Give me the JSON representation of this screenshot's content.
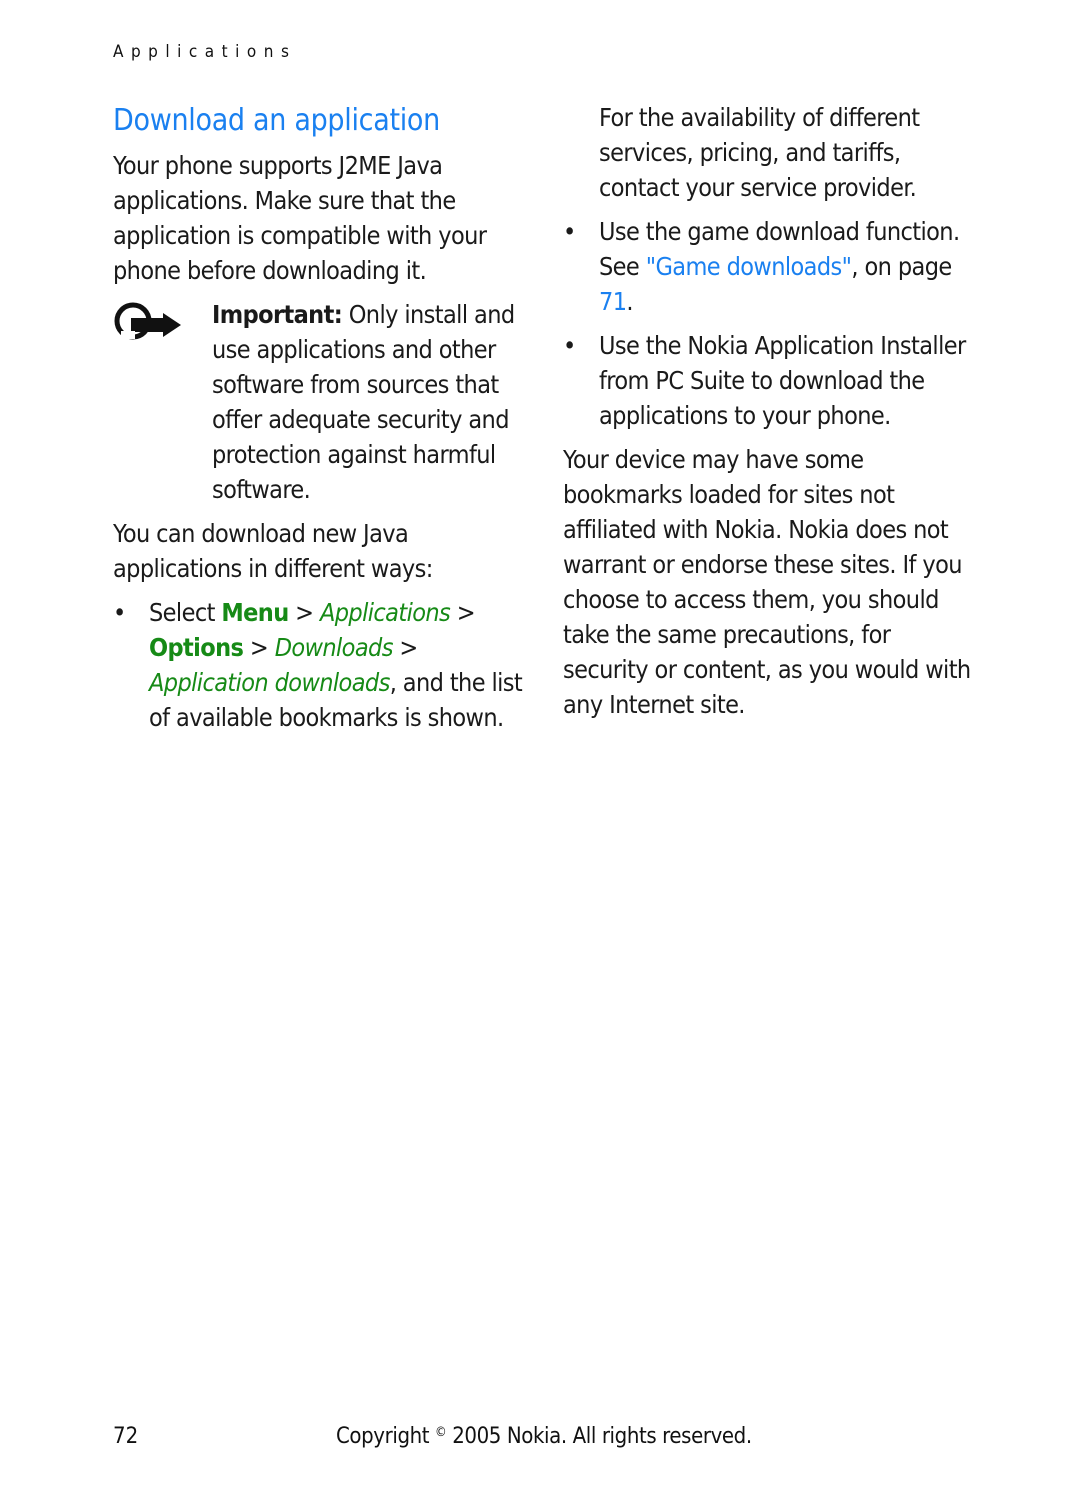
{
  "running_head": "Applications",
  "left_column": {
    "title": "Download an application",
    "intro": "Your phone supports J2ME Java applications. Make sure that the application is compatible with your phone before downloading it.",
    "note": {
      "icon": "important-note-icon",
      "label": "Important:",
      "text": " Only install and use applications and other software from sources that offer adequate security and protection against harmful software."
    },
    "ways_intro": "You can download new Java applications in different ways:",
    "bullet1": {
      "prefix": "Select ",
      "menu": "Menu",
      "sep1": " > ",
      "applications": "Applications",
      "sep2": " > ",
      "options": "Options",
      "sep3": " > ",
      "downloads": "Downloads",
      "sep4": " > ",
      "app_downloads": "Application downloads",
      "suffix": ", and the list of available bookmarks is shown."
    }
  },
  "right_column": {
    "bullet1_cont": "For the availability of different services, pricing, and tariffs, contact your service provider.",
    "bullet2": {
      "prefix": "Use the game download function. See ",
      "link": "\"Game downloads\"",
      "mid": ", on page ",
      "page_link": "71",
      "suffix": "."
    },
    "bullet3": "Use the Nokia Application Installer from PC Suite to download the applications to your phone.",
    "disclaimer": "Your device may have some bookmarks loaded for sites not affiliated with Nokia. Nokia does not warrant or endorse these sites. If you choose to access them, you should take the same precautions, for security or content, as you would with any Internet site."
  },
  "footer": {
    "page_number": "72",
    "copyright_prefix": "Copyright ",
    "copyright_symbol": "©",
    "copyright_suffix": " 2005 Nokia. All rights reserved."
  },
  "colors": {
    "heading_blue": "#1a80f0",
    "menu_green": "#168a16",
    "text": "#1a1a1a"
  },
  "bullet_glyph": "•"
}
